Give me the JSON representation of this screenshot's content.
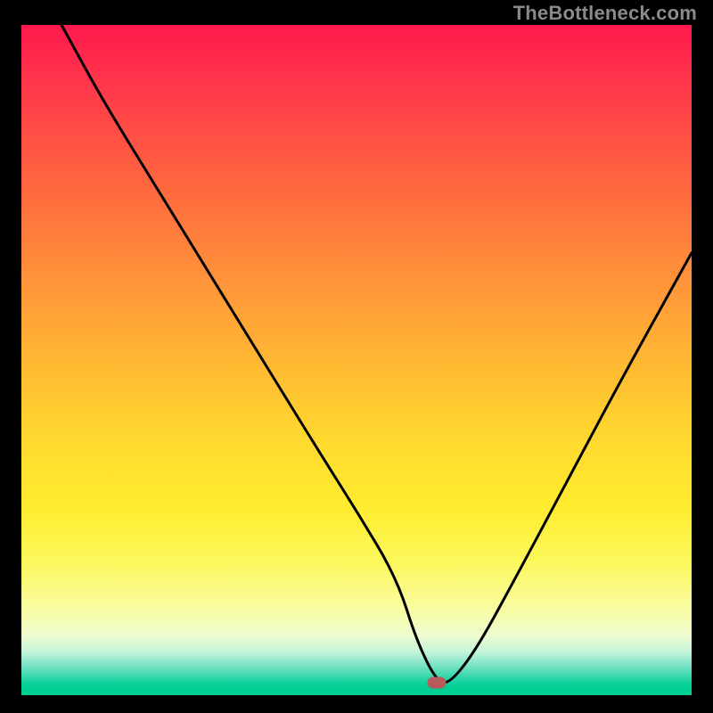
{
  "watermark": "TheBottleneck.com",
  "chart_data": {
    "type": "line",
    "title": "",
    "xlabel": "",
    "ylabel": "",
    "xlim": [
      0,
      100
    ],
    "ylim": [
      0,
      100
    ],
    "grid": false,
    "legend": false,
    "description": "V-shaped bottleneck curve over heat-gradient background (red high = 100 → green low = 0). The minimum (optimal point) sits near x ≈ 62 at y ≈ 0 with a short flat bottom; the curve is steep on both sides.",
    "series": [
      {
        "name": "bottleneck-curve",
        "x": [
          6,
          12,
          20,
          28,
          36,
          44,
          50,
          56,
          59,
          62,
          64,
          68,
          74,
          82,
          90,
          100
        ],
        "values": [
          100,
          89,
          76,
          63,
          50,
          37,
          27.5,
          17.5,
          8,
          2,
          1.8,
          7,
          18,
          33,
          48,
          66
        ]
      }
    ],
    "marker": {
      "x": 62,
      "y": 1.8,
      "color": "#b95a5a"
    },
    "gradient_stops": [
      {
        "pct": 0,
        "color": "#ff1a4d"
      },
      {
        "pct": 50,
        "color": "#ffd92f"
      },
      {
        "pct": 95,
        "color": "#8fe8cc"
      },
      {
        "pct": 100,
        "color": "#00cf93"
      }
    ]
  }
}
